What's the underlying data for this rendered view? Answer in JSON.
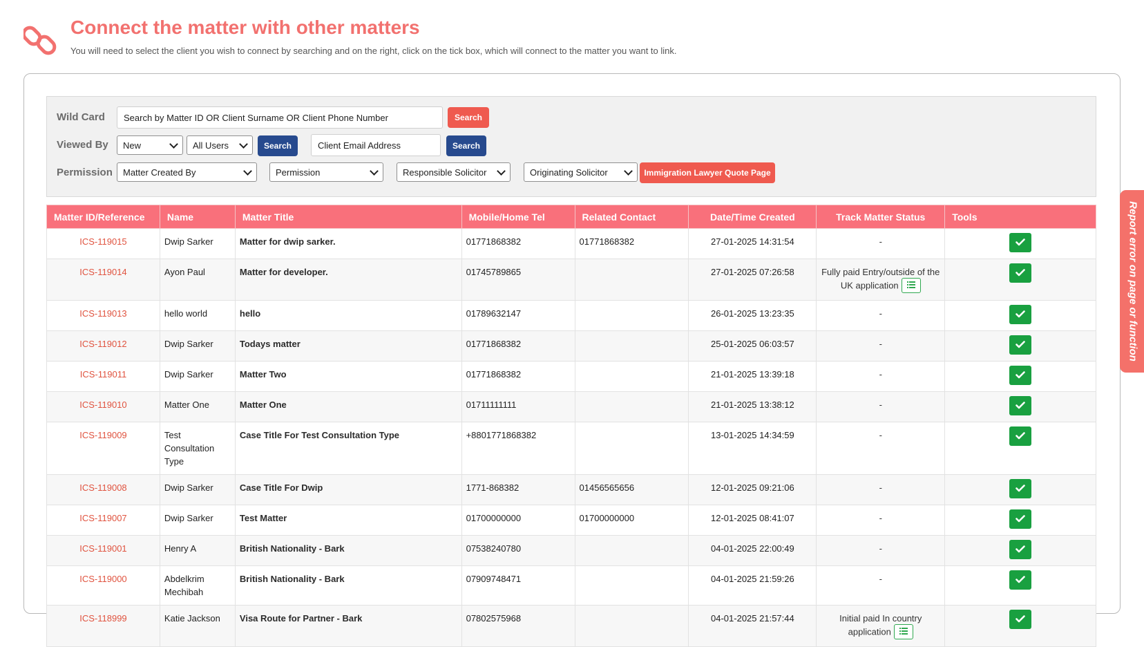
{
  "header": {
    "title": "Connect the matter with other matters",
    "subtitle": "You will need to select the client you wish to connect by searching and on the right, click on the tick box, which will connect to the matter you want to link."
  },
  "filters": {
    "wildcard_label": "Wild Card",
    "wildcard_value": "Search by Matter ID OR Client Surname OR Client Phone Number",
    "search_label": "Search",
    "viewed_by_label": "Viewed By",
    "viewed_by_value": "New",
    "users_value": "All Users",
    "email_value": "Client Email Address",
    "permission_label": "Permission",
    "matter_created_by": "Matter Created By",
    "permission_select": "Permission",
    "responsible_solicitor": "Responsible Solicitor",
    "originating_solicitor": "Originating Solicitor",
    "quote_button": "Immigration Lawyer Quote Page"
  },
  "table": {
    "columns": [
      "Matter ID/Reference",
      "Name",
      "Matter Title",
      "Mobile/Home Tel",
      "Related Contact",
      "Date/Time Created",
      "Track Matter Status",
      "Tools"
    ],
    "rows": [
      {
        "id": "ICS-119015",
        "name": "Dwip Sarker",
        "title": "Matter for dwip sarker.",
        "tel": "01771868382",
        "related": "01771868382",
        "created": "27-01-2025 14:31:54",
        "status": "-"
      },
      {
        "id": "ICS-119014",
        "name": "Ayon Paul",
        "title": "Matter for developer.",
        "tel": "01745789865",
        "related": "",
        "created": "27-01-2025 07:26:58",
        "status": "Fully paid Entry/outside of the UK application",
        "status_icon": "list-icon"
      },
      {
        "id": "ICS-119013",
        "name": "hello world",
        "title": "hello",
        "tel": "01789632147",
        "related": "",
        "created": "26-01-2025 13:23:35",
        "status": "-"
      },
      {
        "id": "ICS-119012",
        "name": "Dwip Sarker",
        "title": "Todays matter",
        "tel": "01771868382",
        "related": "",
        "created": "25-01-2025 06:03:57",
        "status": "-"
      },
      {
        "id": "ICS-119011",
        "name": "Dwip Sarker",
        "title": "Matter Two",
        "tel": "01771868382",
        "related": "",
        "created": "21-01-2025 13:39:18",
        "status": "-"
      },
      {
        "id": "ICS-119010",
        "name": "Matter One",
        "title": "Matter One",
        "tel": "01711111111",
        "related": "",
        "created": "21-01-2025 13:38:12",
        "status": "-"
      },
      {
        "id": "ICS-119009",
        "name": "Test Consultation Type",
        "title": "Case Title For Test Consultation Type",
        "tel": "+8801771868382",
        "related": "",
        "created": "13-01-2025 14:34:59",
        "status": "-"
      },
      {
        "id": "ICS-119008",
        "name": "Dwip Sarker",
        "title": "Case Title For Dwip",
        "tel": "1771-868382",
        "related": "01456565656",
        "created": "12-01-2025 09:21:06",
        "status": "-"
      },
      {
        "id": "ICS-119007",
        "name": "Dwip Sarker",
        "title": "Test Matter",
        "tel": "01700000000",
        "related": "01700000000",
        "created": "12-01-2025 08:41:07",
        "status": "-"
      },
      {
        "id": "ICS-119001",
        "name": "Henry A",
        "title": "British Nationality - Bark",
        "tel": "07538240780",
        "related": "",
        "created": "04-01-2025 22:00:49",
        "status": "-"
      },
      {
        "id": "ICS-119000",
        "name": "Abdelkrim Mechibah",
        "title": "British Nationality - Bark",
        "tel": "07909748471",
        "related": "",
        "created": "04-01-2025 21:59:26",
        "status": "-"
      },
      {
        "id": "ICS-118999",
        "name": "Katie Jackson",
        "title": "Visa Route for Partner - Bark",
        "tel": "07802575968",
        "related": "",
        "created": "04-01-2025 21:57:44",
        "status": "Initial paid In country application",
        "status_icon": "list-icon"
      }
    ]
  },
  "side_tab": {
    "label": "Report error on page or function"
  },
  "colors": {
    "accent": "#f2716f",
    "header_row": "#f9707b",
    "primary": "#274a8e",
    "danger": "#ef5a4f",
    "success": "#19a040"
  }
}
